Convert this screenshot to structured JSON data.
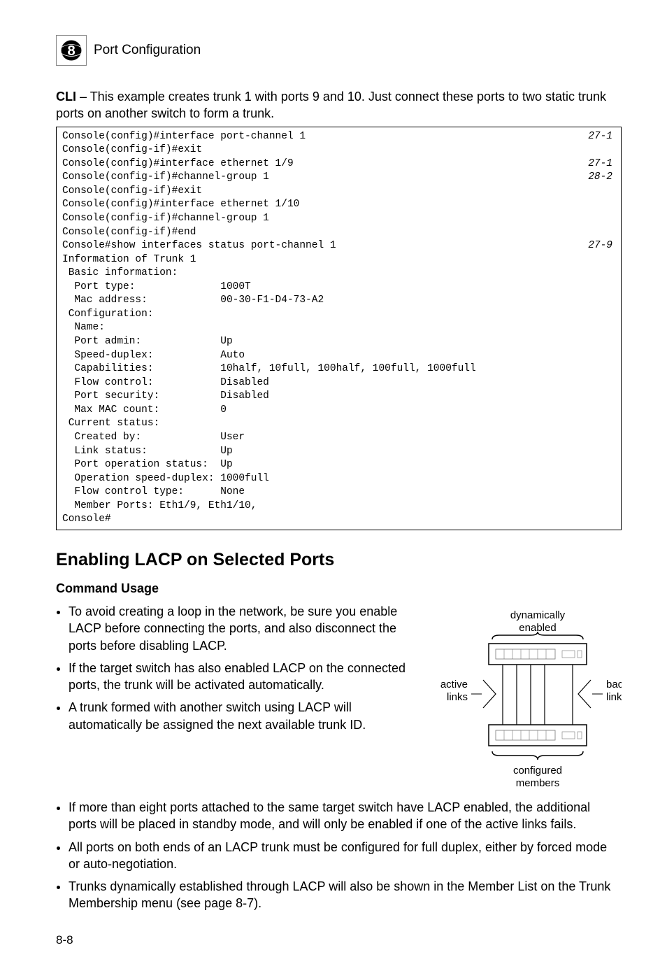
{
  "header": {
    "chapter": "8",
    "title": "Port Configuration"
  },
  "intro": {
    "cli_label": "CLI",
    "intro_text": " – This example creates trunk 1 with ports 9 and 10. Just connect these ports to two static trunk ports on another switch to form a trunk."
  },
  "code": {
    "rows": [
      {
        "l": "Console(config)#interface port-channel 1",
        "r": "27-1"
      },
      {
        "l": "Console(config-if)#exit",
        "r": ""
      },
      {
        "l": "Console(config)#interface ethernet 1/9",
        "r": "27-1"
      },
      {
        "l": "Console(config-if)#channel-group 1",
        "r": "28-2"
      },
      {
        "l": "Console(config-if)#exit",
        "r": ""
      },
      {
        "l": "Console(config)#interface ethernet 1/10",
        "r": ""
      },
      {
        "l": "Console(config-if)#channel-group 1",
        "r": ""
      },
      {
        "l": "Console(config-if)#end",
        "r": ""
      },
      {
        "l": "Console#show interfaces status port-channel 1",
        "r": "27-9"
      },
      {
        "l": "Information of Trunk 1",
        "r": ""
      },
      {
        "l": " Basic information:",
        "r": ""
      },
      {
        "l": "  Port type:              1000T",
        "r": ""
      },
      {
        "l": "  Mac address:            00-30-F1-D4-73-A2",
        "r": ""
      },
      {
        "l": " Configuration:",
        "r": ""
      },
      {
        "l": "  Name:",
        "r": ""
      },
      {
        "l": "  Port admin:             Up",
        "r": ""
      },
      {
        "l": "  Speed-duplex:           Auto",
        "r": ""
      },
      {
        "l": "  Capabilities:           10half, 10full, 100half, 100full, 1000full",
        "r": ""
      },
      {
        "l": "  Flow control:           Disabled",
        "r": ""
      },
      {
        "l": "  Port security:          Disabled",
        "r": ""
      },
      {
        "l": "  Max MAC count:          0",
        "r": ""
      },
      {
        "l": " Current status:",
        "r": ""
      },
      {
        "l": "  Created by:             User",
        "r": ""
      },
      {
        "l": "  Link status:            Up",
        "r": ""
      },
      {
        "l": "  Port operation status:  Up",
        "r": ""
      },
      {
        "l": "  Operation speed-duplex: 1000full",
        "r": ""
      },
      {
        "l": "  Flow control type:      None",
        "r": ""
      },
      {
        "l": "  Member Ports: Eth1/9, Eth1/10,",
        "r": ""
      },
      {
        "l": "Console#",
        "r": ""
      }
    ]
  },
  "section": {
    "title": "Enabling LACP on Selected Ports",
    "cmd_usage": "Command Usage"
  },
  "bullets_left": [
    "To avoid creating a loop in the network, be sure you enable LACP before connecting the ports, and also disconnect the ports before disabling LACP.",
    "If the target switch has also enabled LACP on the connected ports, the trunk will be activated automatically.",
    "A trunk formed with another switch using LACP will automatically be assigned the next available trunk ID."
  ],
  "bullets_full": [
    "If more than eight ports attached to the same target switch have LACP enabled, the additional ports will be placed in standby mode, and will only be enabled if one of the active links fails.",
    "All ports on both ends of an LACP trunk must be configured for full duplex, either by forced mode or auto-negotiation.",
    "Trunks dynamically established through LACP will also be shown in the Member List on the Trunk Membership menu (see page 8-7)."
  ],
  "diagram": {
    "top_label1": "dynamically",
    "top_label2": "enabled",
    "left_label1": "active",
    "left_label2": "links",
    "right_label1": "backup",
    "right_label2": "link",
    "bottom_label1": "configured",
    "bottom_label2": "members"
  },
  "footer": {
    "page_num": "8-8"
  }
}
